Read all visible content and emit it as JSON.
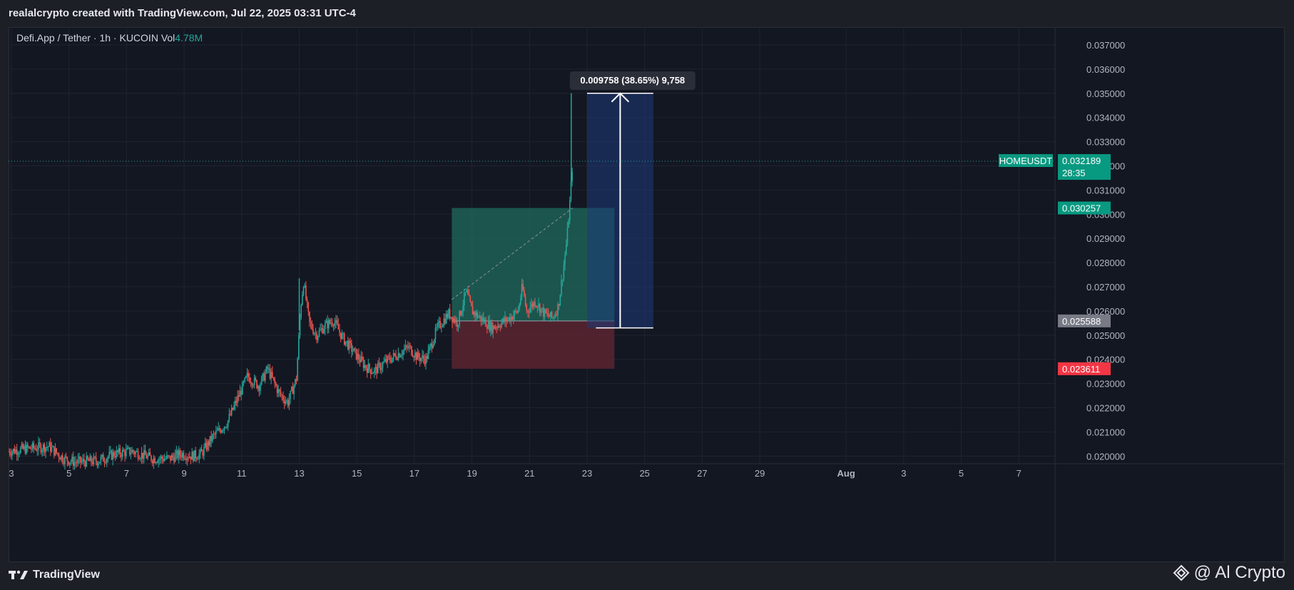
{
  "header": {
    "credit": "realalcrypto created with TradingView.com, Jul 22, 2025 03:31 UTC-4"
  },
  "legend": {
    "symbol_text": "Defi.App / Tether · 1h · KUCOIN",
    "vol_label": "Vol",
    "vol_value": "4.78M"
  },
  "footer": {
    "brand": "TradingView",
    "watermark": "@ Al Crypto"
  },
  "colors": {
    "background": "#131722",
    "grid": "#1f2330",
    "up": "#26a69a",
    "down": "#ef5350",
    "profit_zone": "#1f6b5c",
    "loss_zone": "#5a2430",
    "measure_zone": "#1e3a7a",
    "price_label_current": "#089981",
    "price_label_stop": "#f23645",
    "price_label_entry": "#787b86"
  },
  "chart_data": {
    "type": "candlestick",
    "symbol": "HOMEUSDT",
    "timeframe": "1h",
    "exchange": "KUCOIN",
    "y_axis": {
      "min": 0.0195,
      "max": 0.0375,
      "ticks": [
        "0.037000",
        "0.036000",
        "0.035000",
        "0.034000",
        "0.033000",
        "0.032000",
        "0.031000",
        "0.030000",
        "0.029000",
        "0.028000",
        "0.027000",
        "0.026000",
        "0.025000",
        "0.024000",
        "0.023000",
        "0.022000",
        "0.021000",
        "0.020000"
      ]
    },
    "x_axis": {
      "ticks": [
        {
          "label": "3",
          "day": 3
        },
        {
          "label": "5",
          "day": 5
        },
        {
          "label": "7",
          "day": 7
        },
        {
          "label": "9",
          "day": 9
        },
        {
          "label": "11",
          "day": 11
        },
        {
          "label": "13",
          "day": 13
        },
        {
          "label": "15",
          "day": 15
        },
        {
          "label": "17",
          "day": 17
        },
        {
          "label": "19",
          "day": 19
        },
        {
          "label": "21",
          "day": 21
        },
        {
          "label": "23",
          "day": 23
        },
        {
          "label": "25",
          "day": 25
        },
        {
          "label": "27",
          "day": 27
        },
        {
          "label": "29",
          "day": 29
        },
        {
          "label": "Aug",
          "day": 32,
          "bold": true
        },
        {
          "label": "3",
          "day": 34
        },
        {
          "label": "5",
          "day": 36
        },
        {
          "label": "7",
          "day": 38
        }
      ]
    },
    "price_path": [
      [
        2.9,
        0.0202
      ],
      [
        3.5,
        0.0203
      ],
      [
        4.3,
        0.0204
      ],
      [
        4.8,
        0.0199
      ],
      [
        5.2,
        0.01975
      ],
      [
        6.0,
        0.0198
      ],
      [
        6.6,
        0.0201
      ],
      [
        7.2,
        0.0202
      ],
      [
        7.9,
        0.0199
      ],
      [
        8.5,
        0.0199
      ],
      [
        8.9,
        0.0201
      ],
      [
        9.3,
        0.02
      ],
      [
        9.6,
        0.0201
      ],
      [
        10.0,
        0.0208
      ],
      [
        10.5,
        0.0214
      ],
      [
        10.9,
        0.0225
      ],
      [
        11.2,
        0.0233
      ],
      [
        11.6,
        0.0229
      ],
      [
        11.9,
        0.0236
      ],
      [
        12.3,
        0.0226
      ],
      [
        12.6,
        0.0222
      ],
      [
        12.9,
        0.0232
      ],
      [
        13.05,
        0.0262
      ],
      [
        13.15,
        0.0272
      ],
      [
        13.35,
        0.0255
      ],
      [
        13.6,
        0.025
      ],
      [
        13.9,
        0.0254
      ],
      [
        14.2,
        0.0256
      ],
      [
        14.5,
        0.0249
      ],
      [
        14.9,
        0.0243
      ],
      [
        15.3,
        0.0237
      ],
      [
        15.6,
        0.0235
      ],
      [
        16.0,
        0.0239
      ],
      [
        16.4,
        0.0242
      ],
      [
        16.8,
        0.0245
      ],
      [
        17.1,
        0.0241
      ],
      [
        17.4,
        0.024
      ],
      [
        17.8,
        0.0253
      ],
      [
        18.2,
        0.0259
      ],
      [
        18.5,
        0.0255
      ],
      [
        18.8,
        0.0268
      ],
      [
        19.0,
        0.026
      ],
      [
        19.3,
        0.0257
      ],
      [
        19.7,
        0.0253
      ],
      [
        20.0,
        0.0255
      ],
      [
        20.3,
        0.0257
      ],
      [
        20.6,
        0.026
      ],
      [
        20.75,
        0.027
      ],
      [
        20.9,
        0.026
      ],
      [
        21.2,
        0.0264
      ],
      [
        21.5,
        0.0259
      ],
      [
        21.8,
        0.0257
      ],
      [
        22.0,
        0.0262
      ],
      [
        22.15,
        0.0275
      ],
      [
        22.3,
        0.029
      ],
      [
        22.4,
        0.0305
      ],
      [
        22.5,
        0.0322
      ]
    ],
    "spikes": [
      {
        "day": 13.0,
        "high": 0.02735
      },
      {
        "day": 22.45,
        "high": 0.035
      }
    ],
    "current_price": {
      "value": 0.032189,
      "label": "HOMEUSDT",
      "price_text": "0.032189",
      "countdown": "28:35"
    },
    "price_labels": [
      {
        "value": 0.030257,
        "text": "0.030257",
        "kind": "target"
      },
      {
        "value": 0.025588,
        "text": "0.025588",
        "kind": "entry"
      },
      {
        "value": 0.023611,
        "text": "0.023611",
        "kind": "stop"
      }
    ],
    "long_position": {
      "day_start": 18.3,
      "day_end": 23.95,
      "entry": 0.025588,
      "target": 0.030257,
      "stop": 0.023611
    },
    "measure": {
      "day_start": 23.0,
      "day_end": 25.3,
      "from": 0.0253,
      "to": 0.035,
      "label": "0.009758 (38.65%) 9,758"
    }
  }
}
